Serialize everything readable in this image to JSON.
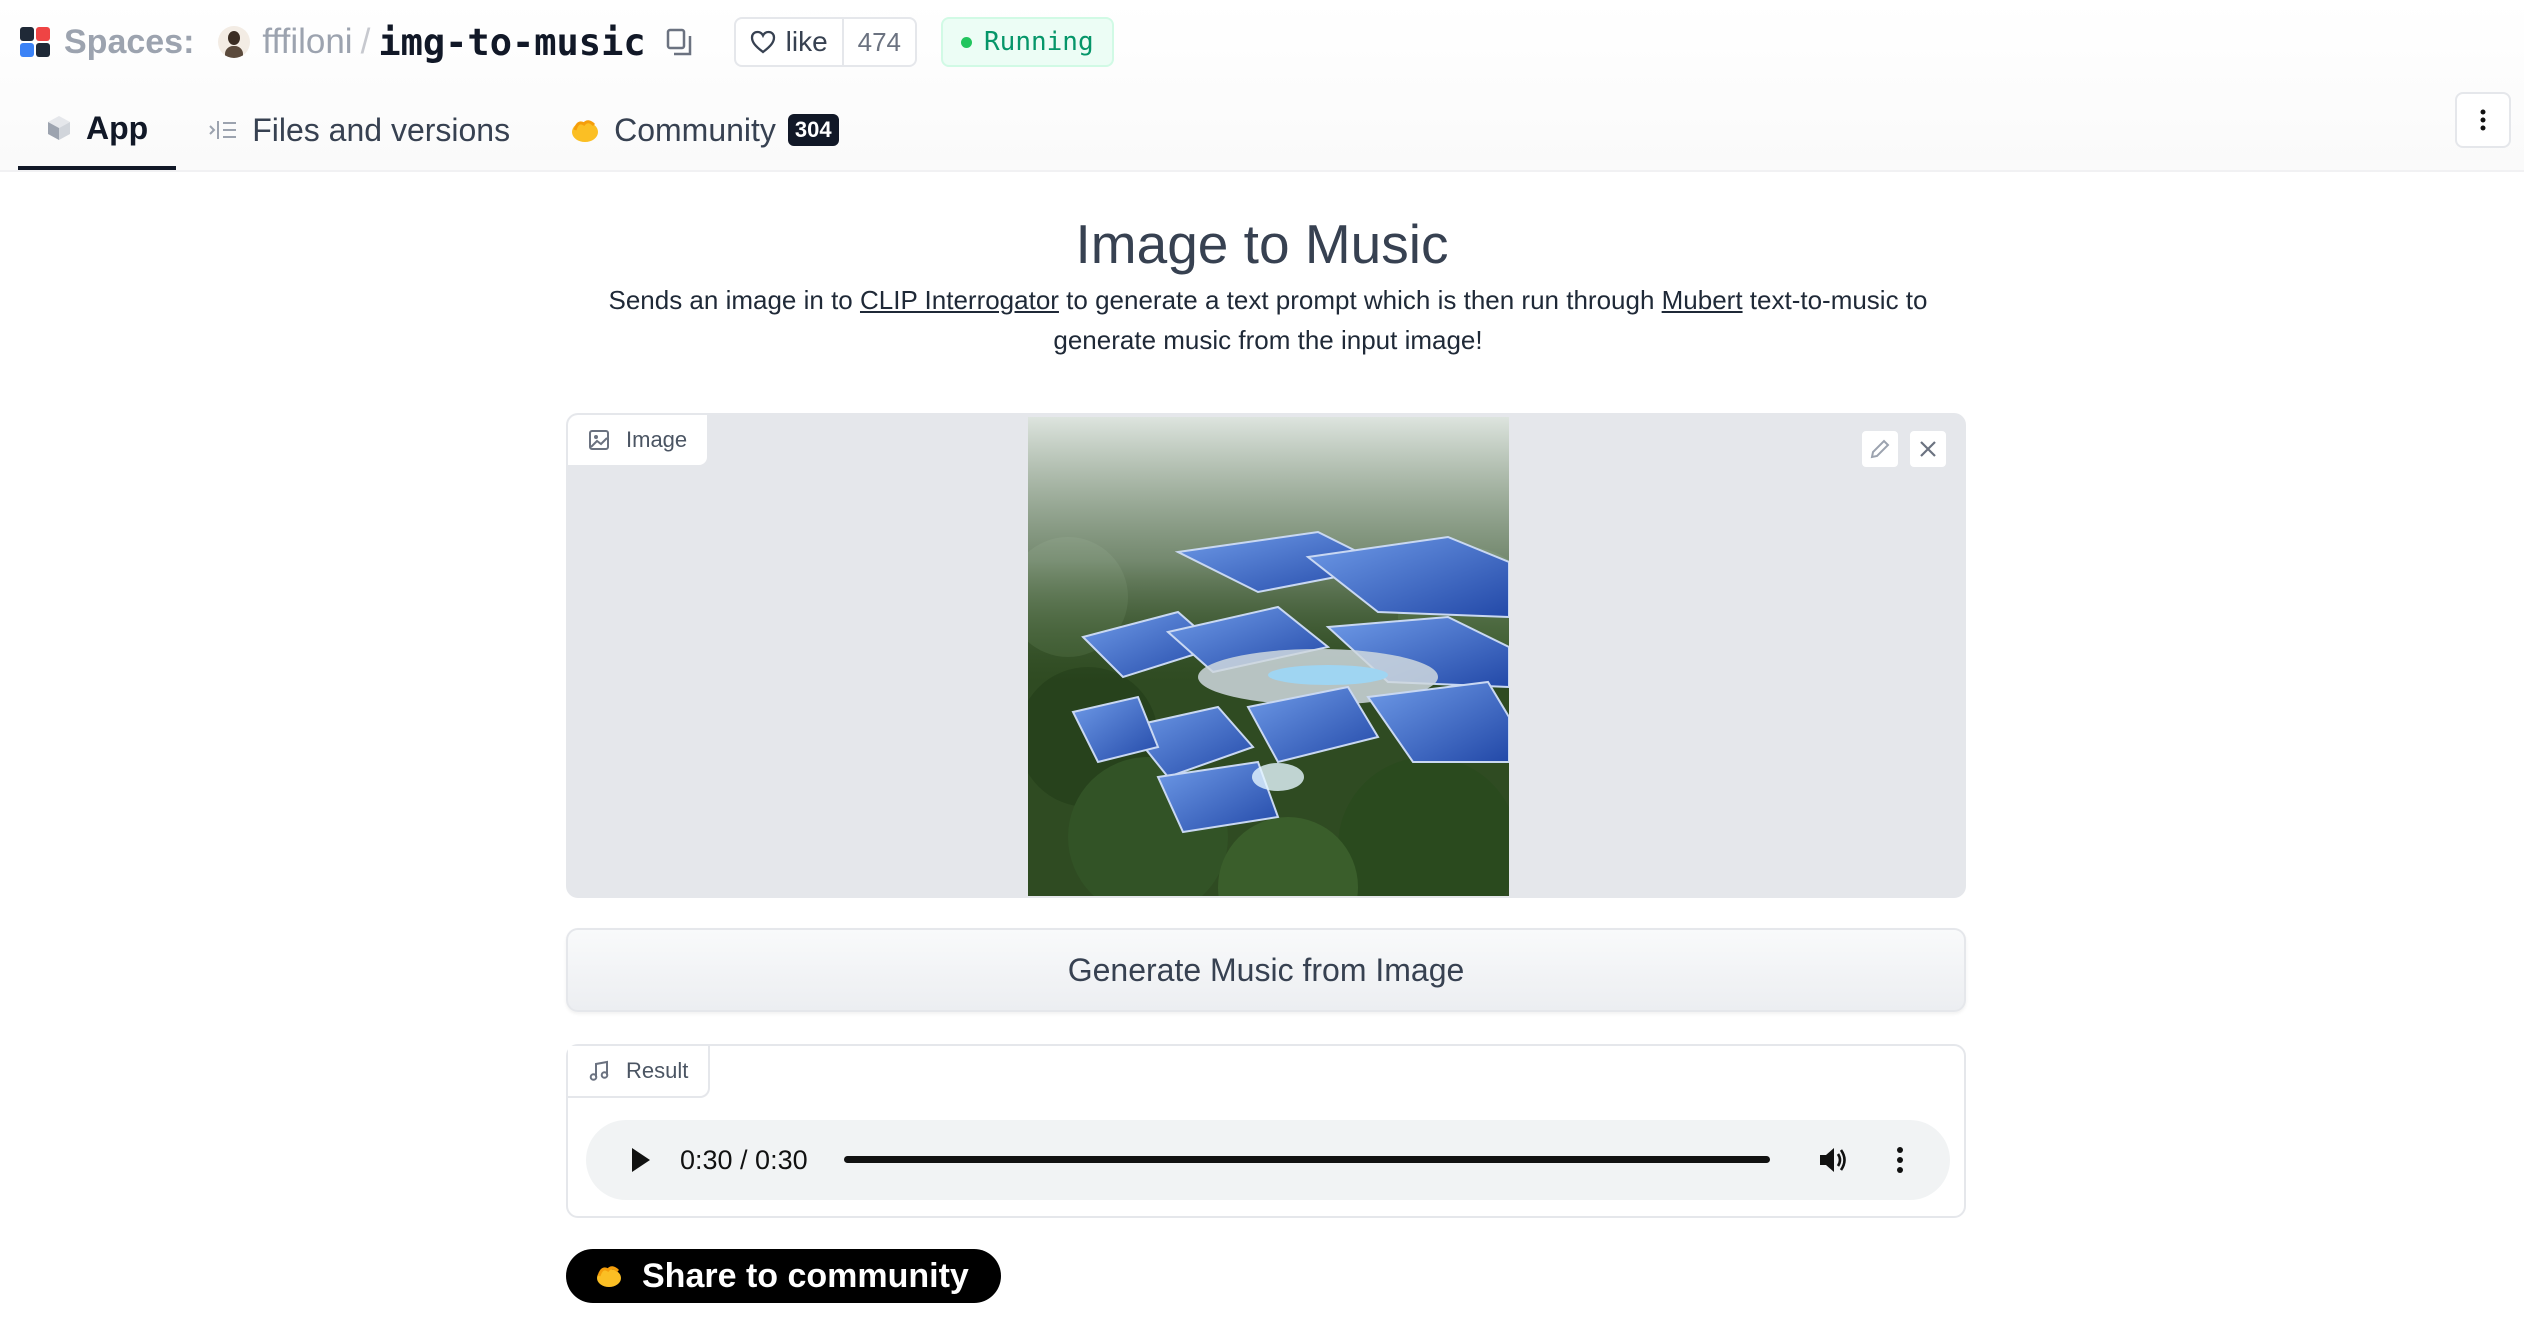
{
  "header": {
    "spaces_label": "Spaces:",
    "owner": "fffiloni",
    "separator": "/",
    "repo": "img-to-music",
    "like_label": "like",
    "like_count": "474",
    "status": "Running",
    "status_color": "#22c55e"
  },
  "tabs": [
    {
      "label": "App",
      "icon": "cube-icon",
      "active": true
    },
    {
      "label": "Files and versions",
      "icon": "files-icon",
      "active": false
    },
    {
      "label": "Community",
      "icon": "hands-icon",
      "active": false,
      "badge": "304"
    }
  ],
  "main": {
    "title": "Image to Music",
    "description": {
      "part1": "Sends an image in to ",
      "link1": "CLIP Interrogator",
      "part2": " to generate a text prompt which is then run through ",
      "link2": "Mubert",
      "part3": " text-to-music to generate music from the input image!"
    },
    "image_block": {
      "label": "Image",
      "tools": [
        "pencil-icon",
        "close-icon"
      ]
    },
    "generate_button": "Generate Music from Image",
    "result_block": {
      "label": "Result",
      "audio_time": "0:30 / 0:30",
      "progress": 1.0
    },
    "share_button": "Share to community"
  }
}
